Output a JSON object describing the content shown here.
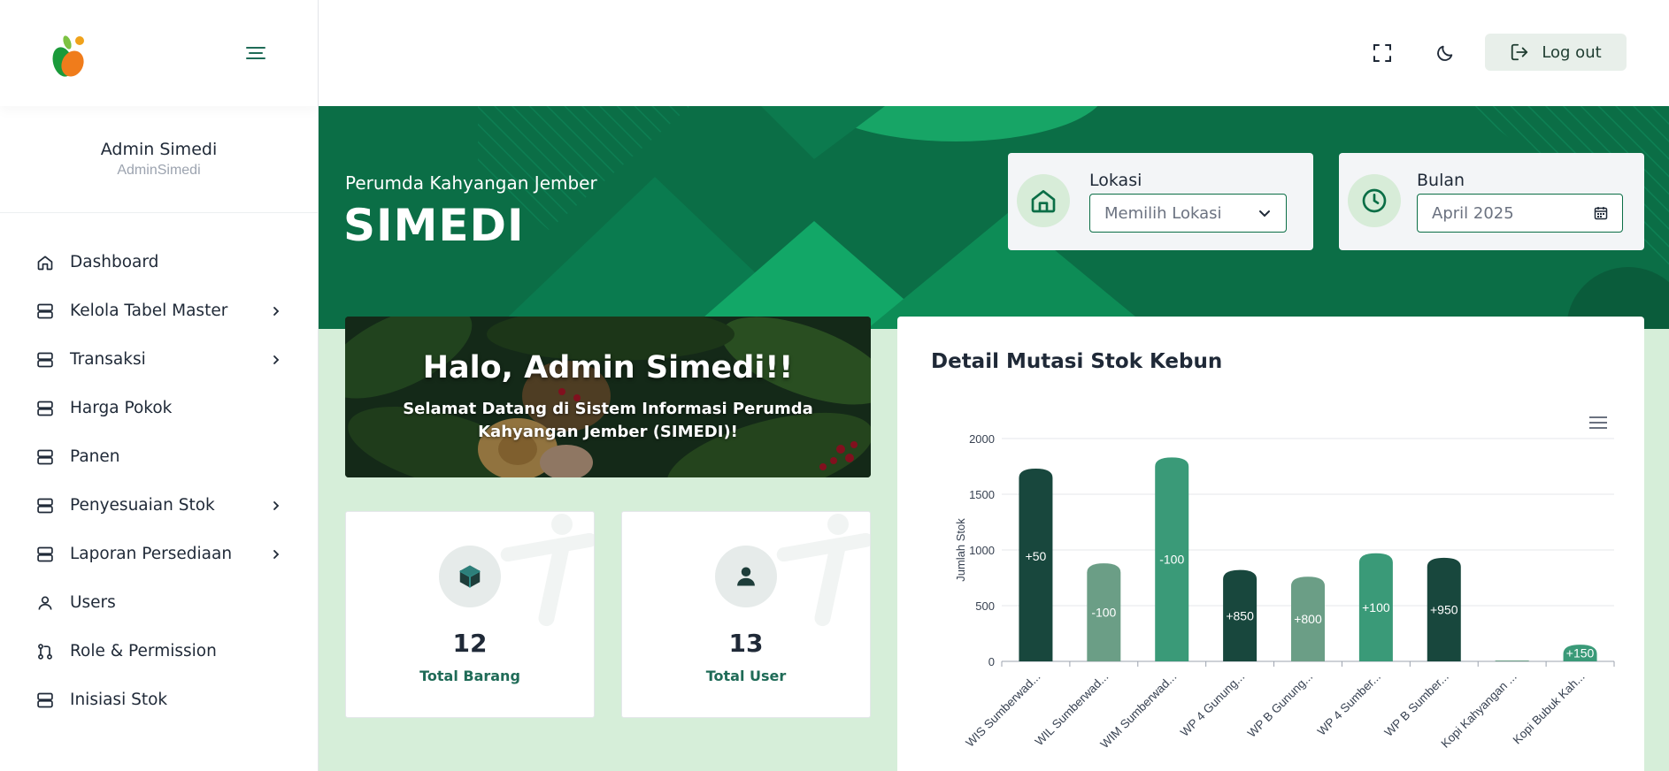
{
  "sidebar": {
    "profile": {
      "name": "Admin Simedi",
      "username": "AdminSimedi"
    },
    "items": [
      {
        "label": "Dashboard",
        "icon": "home-icon",
        "has_children": false
      },
      {
        "label": "Kelola Tabel Master",
        "icon": "server-icon",
        "has_children": true
      },
      {
        "label": "Transaksi",
        "icon": "server-icon",
        "has_children": true
      },
      {
        "label": "Harga Pokok",
        "icon": "server-icon",
        "has_children": false
      },
      {
        "label": "Panen",
        "icon": "server-icon",
        "has_children": false
      },
      {
        "label": "Penyesuaian Stok",
        "icon": "server-icon",
        "has_children": true
      },
      {
        "label": "Laporan Persediaan",
        "icon": "server-icon",
        "has_children": true
      },
      {
        "label": "Users",
        "icon": "user-icon",
        "has_children": false
      },
      {
        "label": "Role & Permission",
        "icon": "git-pull-request-icon",
        "has_children": false
      },
      {
        "label": "Inisiasi Stok",
        "icon": "server-icon",
        "has_children": false
      }
    ]
  },
  "topbar": {
    "logout_label": "Log out"
  },
  "hero": {
    "subtitle": "Perumda Kahyangan Jember",
    "title": "SIMEDI",
    "lokasi": {
      "label": "Lokasi",
      "value": "Memilih Lokasi"
    },
    "bulan": {
      "label": "Bulan",
      "value": "April 2025"
    }
  },
  "banner": {
    "title": "Halo, Admin Simedi!!",
    "subtitle": "Selamat Datang di Sistem Informasi Perumda Kahyangan Jember (SIMEDI)!"
  },
  "stats": [
    {
      "value": "12",
      "label": "Total Barang",
      "icon": "box-icon"
    },
    {
      "value": "13",
      "label": "Total User",
      "icon": "user-icon"
    }
  ],
  "colors": {
    "primary": "#0b6e46",
    "dark_bar": "#18473d",
    "mid_bar": "#3a9a78",
    "light_bar": "#6b9e86",
    "bg": "#d6eed9"
  },
  "chart_title": "Detail Mutasi Stok Kebun",
  "chart_data": {
    "type": "bar",
    "title": "Detail Mutasi Stok Kebun",
    "xlabel": "",
    "ylabel": "Jumlah Stok",
    "ylim": [
      0,
      2000
    ],
    "yticks": [
      0,
      500,
      1000,
      1500,
      2000
    ],
    "grid": true,
    "categories": [
      "WIS Sumberwad...",
      "WIL Sumberwad...",
      "WIM Sumberwad...",
      "WP 4 Gunung...",
      "WP B Gunung...",
      "WP 4 Sumber...",
      "WP B Sumber...",
      "Kopi Kahyangan ...",
      "Kopi Bubuk Kah..."
    ],
    "values": [
      1730,
      880,
      1830,
      820,
      760,
      970,
      930,
      5,
      150
    ],
    "labels": [
      "+50",
      "-100",
      "-100",
      "+850",
      "+800",
      "+100",
      "+950",
      "",
      "+150"
    ],
    "bar_colors": [
      "#18473d",
      "#6b9e86",
      "#3a9a78",
      "#18473d",
      "#6b9e86",
      "#3a9a78",
      "#18473d",
      "#6b9e86",
      "#3a9a78"
    ]
  }
}
